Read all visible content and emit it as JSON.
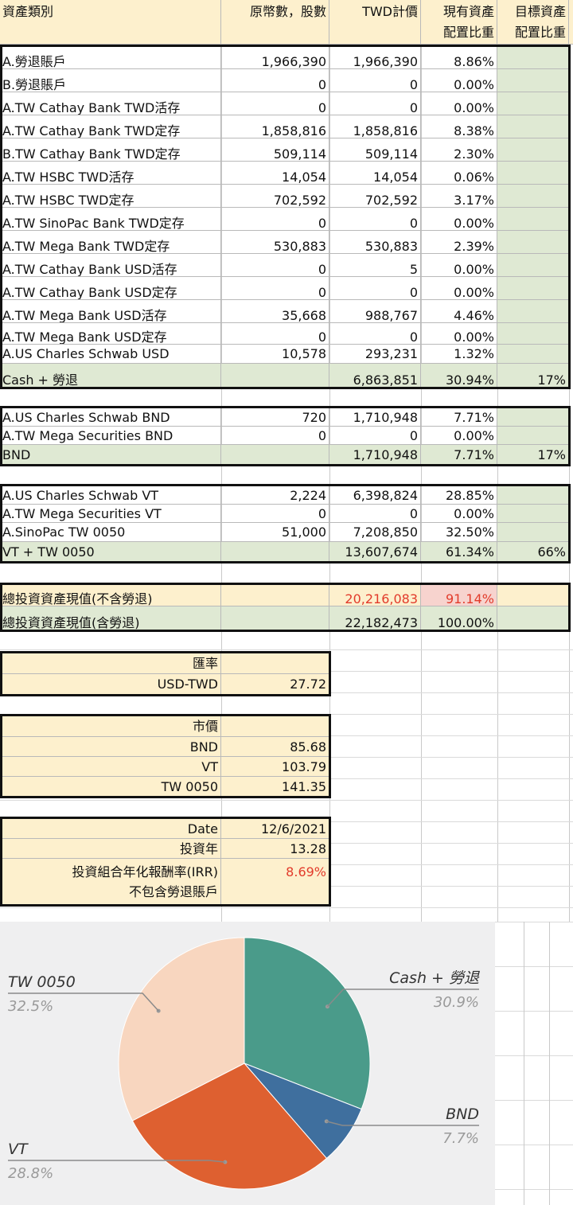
{
  "header": {
    "col_category": "資產類別",
    "col_original": "原幣數，股數",
    "col_twd": "TWD計價",
    "col_current_1": "現有資產",
    "col_current_2": "配置比重",
    "col_target_1": "目標資產",
    "col_target_2": "配置比重"
  },
  "cash_rows": [
    {
      "name": "A.勞退賬戶",
      "orig": "1,966,390",
      "twd": "1,966,390",
      "pct": "8.86%"
    },
    {
      "name": "B.勞退賬戶",
      "orig": "0",
      "twd": "0",
      "pct": "0.00%"
    },
    {
      "name": "A.TW Cathay Bank TWD活存",
      "orig": "0",
      "twd": "0",
      "pct": "0.00%"
    },
    {
      "name": "A.TW Cathay Bank TWD定存",
      "orig": "1,858,816",
      "twd": "1,858,816",
      "pct": "8.38%"
    },
    {
      "name": "B.TW Cathay Bank TWD定存",
      "orig": "509,114",
      "twd": "509,114",
      "pct": "2.30%"
    },
    {
      "name": "A.TW HSBC TWD活存",
      "orig": "14,054",
      "twd": "14,054",
      "pct": "0.06%"
    },
    {
      "name": "A.TW HSBC TWD定存",
      "orig": "702,592",
      "twd": "702,592",
      "pct": "3.17%"
    },
    {
      "name": "A.TW SinoPac Bank TWD定存",
      "orig": "0",
      "twd": "0",
      "pct": "0.00%"
    },
    {
      "name": "A.TW Mega Bank TWD定存",
      "orig": "530,883",
      "twd": "530,883",
      "pct": "2.39%"
    },
    {
      "name": "A.TW Cathay Bank USD活存",
      "orig": "0",
      "twd": "5",
      "pct": "0.00%"
    },
    {
      "name": "A.TW Cathay Bank USD定存",
      "orig": "0",
      "twd": "0",
      "pct": "0.00%"
    },
    {
      "name": "A.TW Mega Bank USD活存",
      "orig": "35,668",
      "twd": "988,767",
      "pct": "4.46%"
    },
    {
      "name": "A.TW Mega Bank USD定存",
      "orig": "0",
      "twd": "0",
      "pct": "0.00%"
    },
    {
      "name": "A.US Charles Schwab USD",
      "orig": "10,578",
      "twd": "293,231",
      "pct": "1.32%"
    }
  ],
  "cash_total": {
    "name": "Cash + 勞退",
    "twd": "6,863,851",
    "pct": "30.94%",
    "target": "17%"
  },
  "bnd_rows": [
    {
      "name": "A.US Charles Schwab BND",
      "orig": "720",
      "twd": "1,710,948",
      "pct": "7.71%"
    },
    {
      "name": "A.TW Mega Securities BND",
      "orig": "0",
      "twd": "0",
      "pct": "0.00%"
    }
  ],
  "bnd_total": {
    "name": "BND",
    "twd": "1,710,948",
    "pct": "7.71%",
    "target": "17%"
  },
  "vt_rows": [
    {
      "name": "A.US Charles Schwab VT",
      "orig": "2,224",
      "twd": "6,398,824",
      "pct": "28.85%"
    },
    {
      "name": "A.TW Mega Securities VT",
      "orig": "0",
      "twd": "0",
      "pct": "0.00%"
    },
    {
      "name": "A.SinoPac TW 0050",
      "orig": "51,000",
      "twd": "7,208,850",
      "pct": "32.50%"
    }
  ],
  "vt_total": {
    "name": "VT + TW 0050",
    "twd": "13,607,674",
    "pct": "61.34%",
    "target": "66%"
  },
  "summary": [
    {
      "name": "總投資資產現值(不含勞退)",
      "twd": "20,216,083",
      "pct": "91.14%"
    },
    {
      "name": "總投資資產現值(含勞退)",
      "twd": "22,182,473",
      "pct": "100.00%"
    }
  ],
  "fx": {
    "title": "匯率",
    "label": "USD-TWD",
    "value": "27.72"
  },
  "market": {
    "title": "市價",
    "rows": [
      {
        "label": "BND",
        "value": "85.68"
      },
      {
        "label": "VT",
        "value": "103.79"
      },
      {
        "label": "TW 0050",
        "value": "141.35"
      }
    ]
  },
  "perf": {
    "date_label": "Date",
    "date_value": "12/6/2021",
    "years_label": "投資年",
    "years_value": "13.28",
    "irr_label_1": "投資組合年化報酬率(IRR)",
    "irr_label_2": "不包含勞退賬戶",
    "irr_value": "8.69%"
  },
  "colors": {
    "header_bg": "#fdf0cd",
    "total_bg": "#dfe9d3",
    "highlight_red": "#e23b2b",
    "highlight_pink": "#f7d3ce"
  },
  "chart_data": {
    "type": "pie",
    "slices": [
      {
        "label": "Cash + 勞退",
        "value": 30.9,
        "display": "30.9%",
        "color": "#4a9b8a"
      },
      {
        "label": "BND",
        "value": 7.7,
        "display": "7.7%",
        "color": "#3f6f9e"
      },
      {
        "label": "VT",
        "value": 28.8,
        "display": "28.8%",
        "color": "#de6030"
      },
      {
        "label": "TW 0050",
        "value": 32.5,
        "display": "32.5%",
        "color": "#f8d6bf"
      }
    ]
  }
}
